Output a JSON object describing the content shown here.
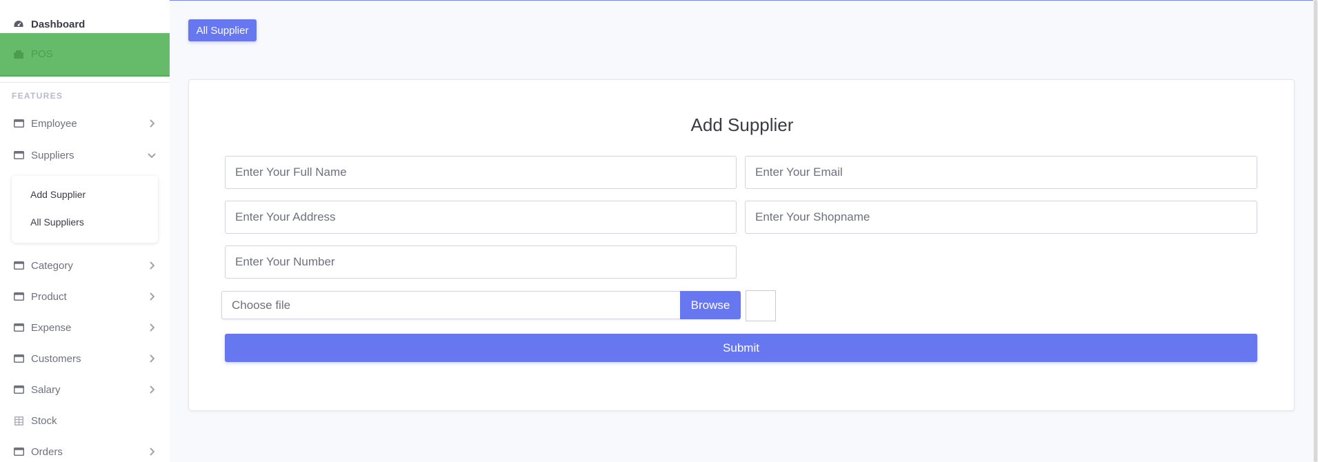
{
  "sidebar": {
    "dashboard": "Dashboard",
    "pos": "POS",
    "features_heading": "FEATURES",
    "items": [
      {
        "label": "Employee",
        "icon": "window-icon",
        "chevron": "right"
      },
      {
        "label": "Suppliers",
        "icon": "window-icon",
        "chevron": "down"
      },
      {
        "label": "Category",
        "icon": "window-icon",
        "chevron": "right"
      },
      {
        "label": "Product",
        "icon": "window-icon",
        "chevron": "right"
      },
      {
        "label": "Expense",
        "icon": "window-icon",
        "chevron": "right"
      },
      {
        "label": "Customers",
        "icon": "window-icon",
        "chevron": "right"
      },
      {
        "label": "Salary",
        "icon": "window-icon",
        "chevron": "right"
      },
      {
        "label": "Stock",
        "icon": "table-icon"
      },
      {
        "label": "Orders",
        "icon": "window-icon",
        "chevron": "right"
      }
    ],
    "submenu": [
      "Add Supplier",
      "All Suppliers"
    ]
  },
  "header": {
    "all_supplier_button": "All Supplier"
  },
  "form": {
    "title": "Add Supplier",
    "full_name_placeholder": "Enter Your Full Name",
    "email_placeholder": "Enter Your Email",
    "address_placeholder": "Enter Your Address",
    "shopname_placeholder": "Enter Your Shopname",
    "number_placeholder": "Enter Your Number",
    "file_label": "Choose file",
    "browse_label": "Browse",
    "submit_label": "Submit"
  },
  "colors": {
    "primary": "#6777ef",
    "active_nav": "#66bb6a",
    "text": "#6e707e"
  }
}
